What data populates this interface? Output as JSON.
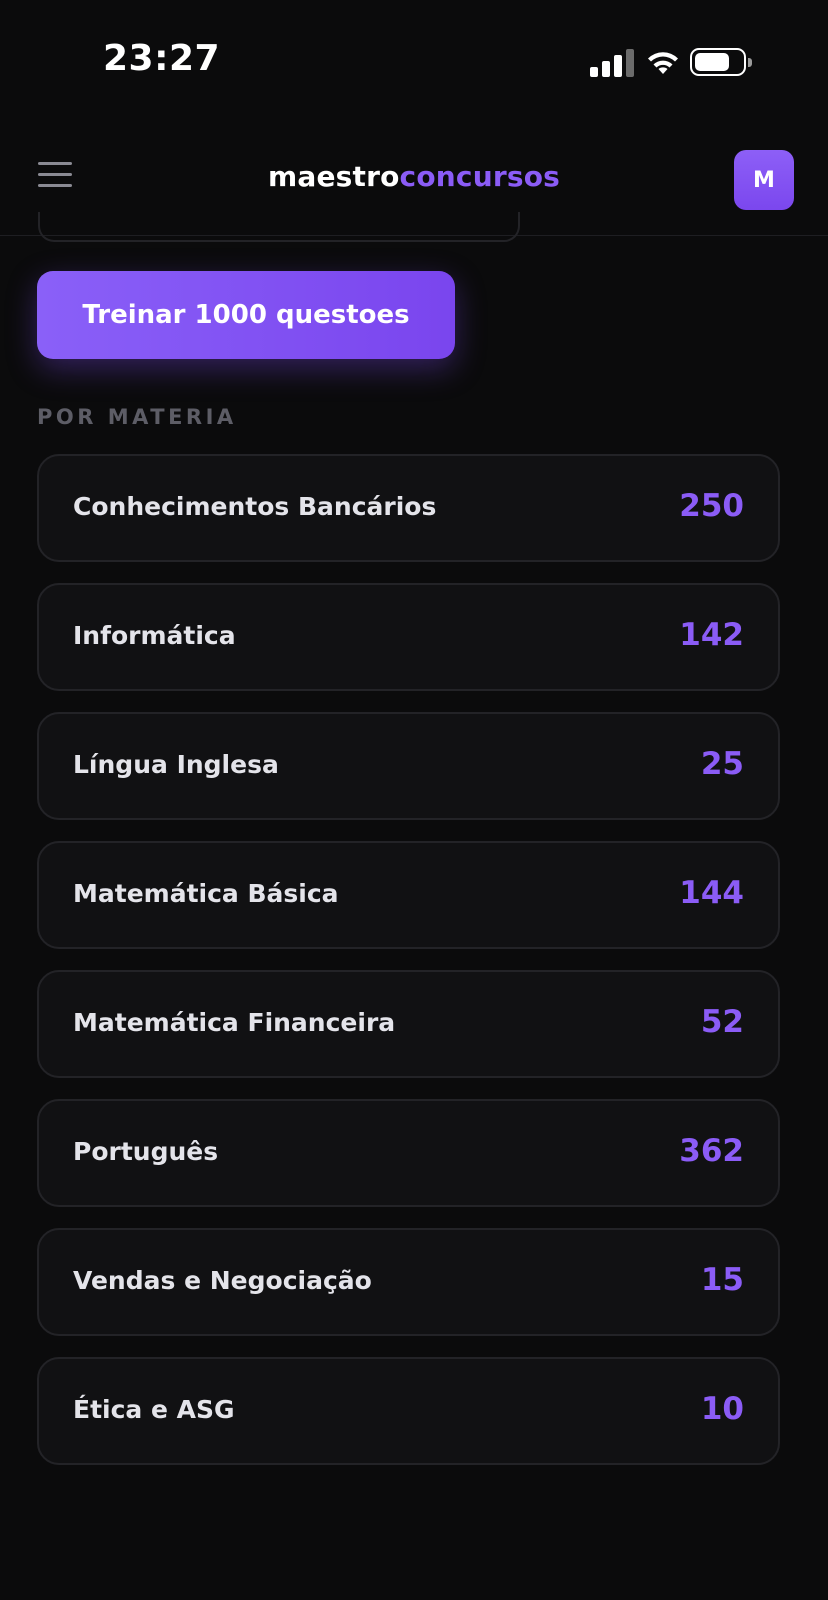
{
  "status_bar": {
    "time": "23:27",
    "icons": [
      "signal-icon",
      "wifi-icon",
      "battery-icon"
    ]
  },
  "header": {
    "brand_part1": "maestro",
    "brand_part2": "concursos",
    "avatar_letter": "M",
    "menu_icon": "hamburger-menu-icon"
  },
  "colors": {
    "accent": "#8b5cf6",
    "background": "#0b0b0c",
    "card": "#111113"
  },
  "train_button": {
    "label": "Treinar 1000 questoes"
  },
  "section": {
    "title": "POR MATERIA"
  },
  "subjects": [
    {
      "name": "Conhecimentos Bancários",
      "count": "250"
    },
    {
      "name": "Informática",
      "count": "142"
    },
    {
      "name": "Língua Inglesa",
      "count": "25"
    },
    {
      "name": "Matemática Básica",
      "count": "144"
    },
    {
      "name": "Matemática Financeira",
      "count": "52"
    },
    {
      "name": "Português",
      "count": "362"
    },
    {
      "name": "Vendas e Negociação",
      "count": "15"
    },
    {
      "name": "Ética e ASG",
      "count": "10"
    }
  ]
}
